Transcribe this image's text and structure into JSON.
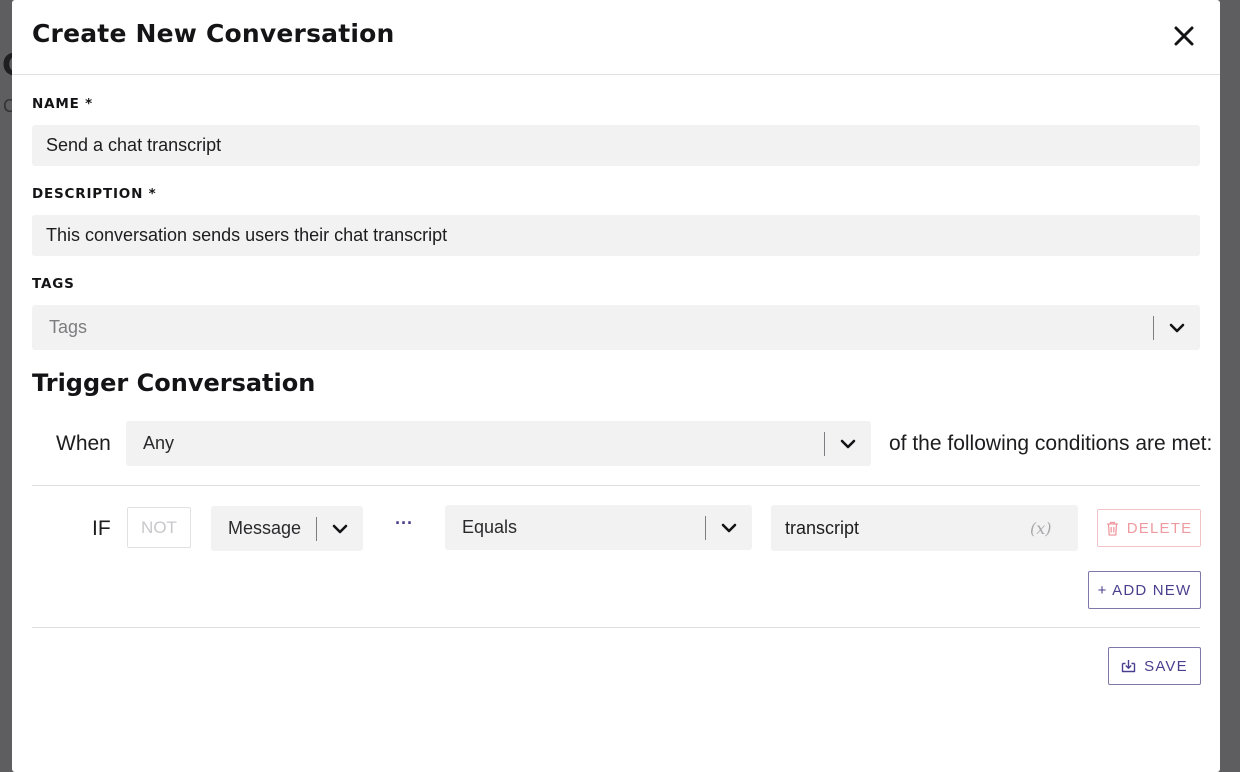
{
  "background": {
    "peek_title": "C",
    "peek_sub": "C"
  },
  "modal": {
    "title": "Create New Conversation",
    "close_icon": "close-icon"
  },
  "form": {
    "name_label": "NAME *",
    "name_value": "Send a chat transcript",
    "description_label": "DESCRIPTION *",
    "description_value": "This conversation sends users their chat transcript",
    "tags_label": "TAGS",
    "tags_placeholder": "Tags"
  },
  "trigger": {
    "section_title": "Trigger Conversation",
    "when_label": "When",
    "match_select": "Any",
    "suffix_text": "of the following conditions are met:"
  },
  "condition": {
    "if_label": "IF",
    "not_label": "NOT",
    "field_select": "Message",
    "more_icon": "···",
    "operator_select": "Equals",
    "value": "transcript",
    "variable_icon": "(x)",
    "delete_label": "DELETE"
  },
  "actions": {
    "add_new_label": "+ ADD NEW",
    "save_label": "SAVE"
  },
  "colors": {
    "accent": "#4a3f8f",
    "danger": "#ef9aa0",
    "input_bg": "#f2f2f2",
    "overlay": "#5e5e60"
  }
}
